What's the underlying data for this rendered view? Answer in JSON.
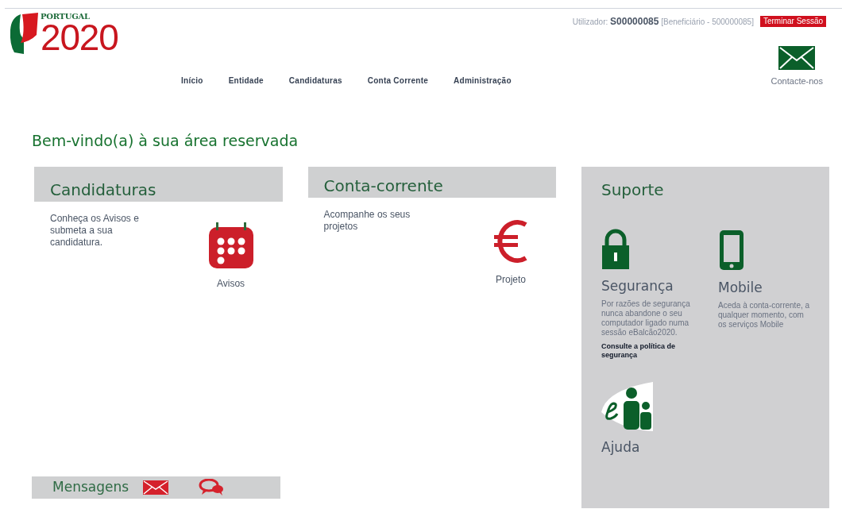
{
  "logo": {
    "country": "PORTUGAL",
    "year": "2020"
  },
  "user": {
    "label": "Utilizador:",
    "id": "S00000085",
    "role": "[Beneficiário - 500000085]"
  },
  "logout": "Terminar Sessão",
  "nav": [
    "Início",
    "Entidade",
    "Candidaturas",
    "Conta Corrente",
    "Administração"
  ],
  "contact": "Contacte-nos",
  "welcome": "Bem-vindo(a) à sua área reservada",
  "cards": [
    {
      "kind": "calendar",
      "title": "Candidaturas",
      "text": "Conheça os Avisos e submeta a sua candidatura.",
      "link": "Avisos"
    },
    {
      "kind": "euro",
      "title": "Conta-corrente",
      "text": "Acompanhe os seus projetos",
      "link": "Projeto"
    }
  ],
  "support": {
    "title": "Suporte",
    "items": [
      {
        "kind": "lock",
        "title": "Segurança",
        "text": "Por razões de segurança nunca abandone o seu computador ligado numa sessão eBalcão2020.",
        "link": "Consulte a política de segurança"
      },
      {
        "kind": "phone",
        "title": "Mobile",
        "text": "Aceda à conta-corrente, a qualquer momento, com os serviços Mobile"
      },
      {
        "kind": "help",
        "title": "Ajuda"
      }
    ]
  },
  "messages": {
    "title": "Mensagens"
  }
}
